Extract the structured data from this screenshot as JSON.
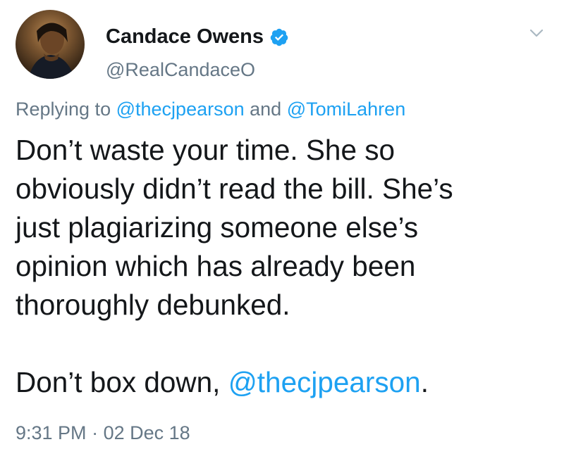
{
  "author": {
    "display_name": "Candace Owens",
    "handle": "@RealCandaceO",
    "verified": true,
    "verified_icon": "verified-badge-icon"
  },
  "reply": {
    "prefix": "Replying to",
    "mention_1": "@thecjpearson",
    "connector": "and",
    "mention_2": "@TomiLahren"
  },
  "body": {
    "line_1": "Don’t waste your time. She so",
    "line_2": "obviously didn’t read the bill. She’s",
    "line_3": "just plagiarizing someone else’s",
    "line_4": "opinion which has already been",
    "line_5": "thoroughly debunked.",
    "line_6_prefix": "Don’t box down, ",
    "line_6_mention": "@thecjpearson",
    "line_6_suffix": "."
  },
  "timestamp": {
    "time": "9:31 PM",
    "separator": "·",
    "date": "02 Dec 18"
  },
  "colors": {
    "link": "#1da1f2",
    "secondary_text": "#657786",
    "primary_text": "#14171a"
  }
}
